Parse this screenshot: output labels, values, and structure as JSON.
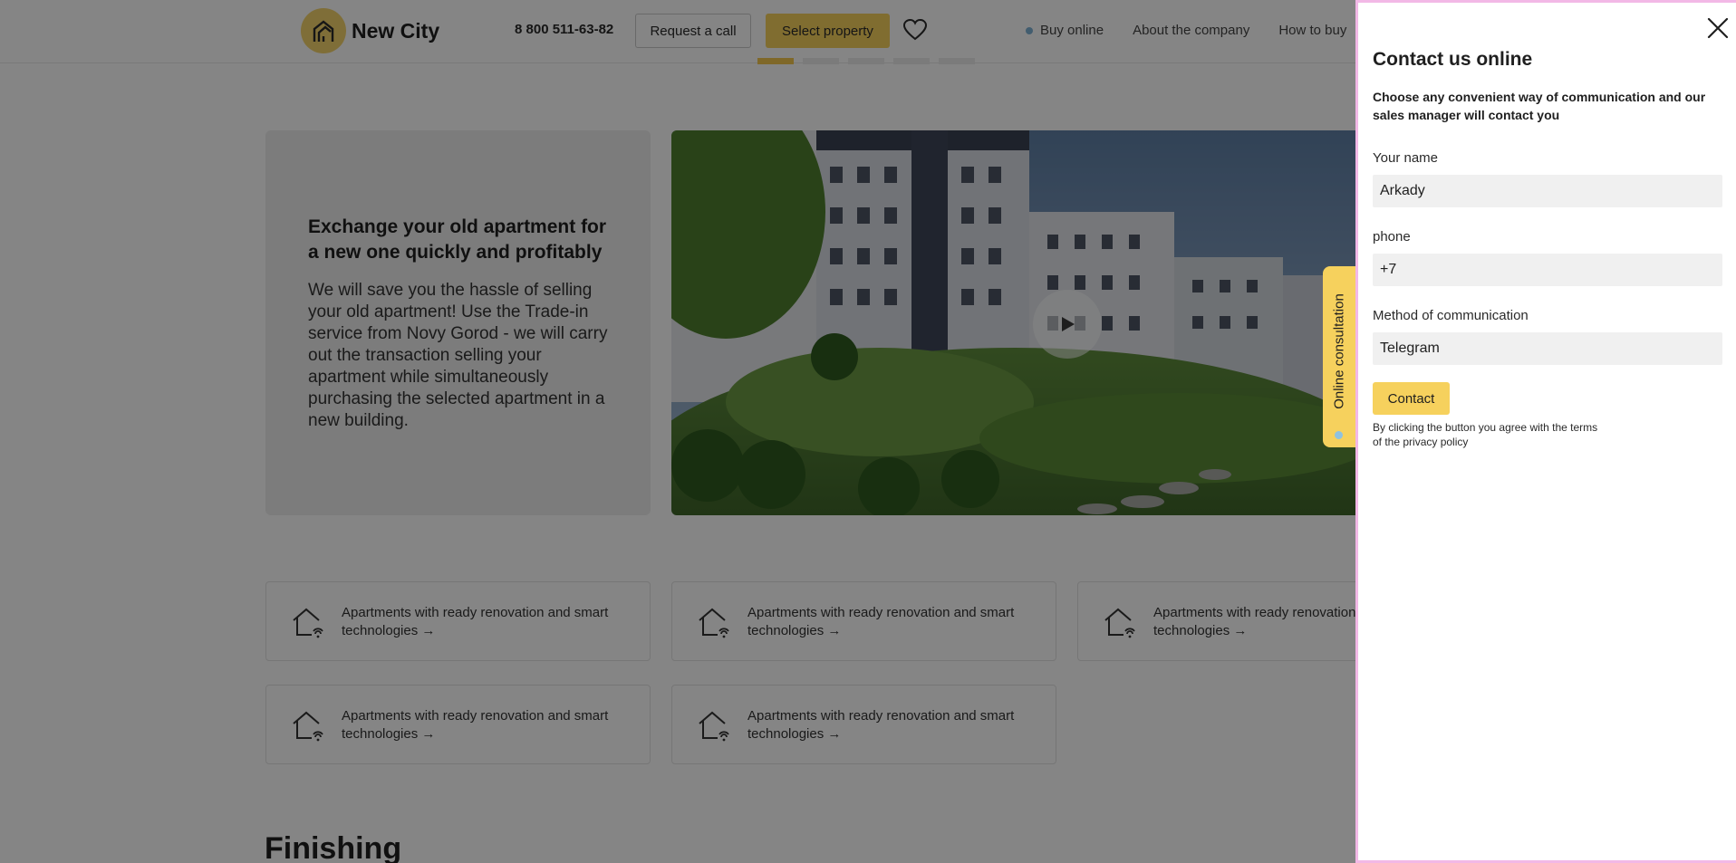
{
  "header": {
    "logo_text": "New City",
    "phone": "8 800 511-63-82",
    "request_call_label": "Request a call",
    "select_property_label": "Select property",
    "nav": [
      {
        "label": "Buy online"
      },
      {
        "label": "About the company"
      },
      {
        "label": "How to buy"
      }
    ]
  },
  "promo": {
    "title": "Exchange your old apartment for a new one quickly and profitably",
    "text": "We will save you the hassle of selling your old apartment! Use the Trade-in service from Novy Gorod - we will carry out the transaction selling your apartment while simultaneously purchasing the selected apartment in a new building."
  },
  "features": [
    {
      "text": "Apartments with ready renovation and smart technologies →"
    },
    {
      "text": "Apartments with ready renovation and smart technologies →"
    },
    {
      "text": "Apartments with ready renovation and smart technologies →"
    },
    {
      "text": "Apartments with ready renovation and smart technologies →"
    },
    {
      "text": "Apartments with ready renovation and smart technologies →"
    }
  ],
  "section": {
    "finishing_title": "Finishing"
  },
  "side_tab": {
    "label": "Online consultation"
  },
  "panel": {
    "title": "Contact us online",
    "subtitle": "Choose any convenient way of communication and our sales manager will contact you",
    "name_label": "Your name",
    "name_value": "Arkady",
    "phone_label": "phone",
    "phone_value": "+7",
    "method_label": "Method of communication",
    "method_value": "Telegram",
    "contact_label": "Contact",
    "agree_text": "By clicking the button you agree with the terms of the privacy policy"
  },
  "colors": {
    "accent_yellow": "#f6d15d",
    "panel_border_pink": "#f2b8e6",
    "dot_blue": "#8fc2e0"
  },
  "icons": [
    "logo-mark-icon",
    "heart-icon",
    "play-icon",
    "smart-home-icon",
    "close-icon"
  ]
}
